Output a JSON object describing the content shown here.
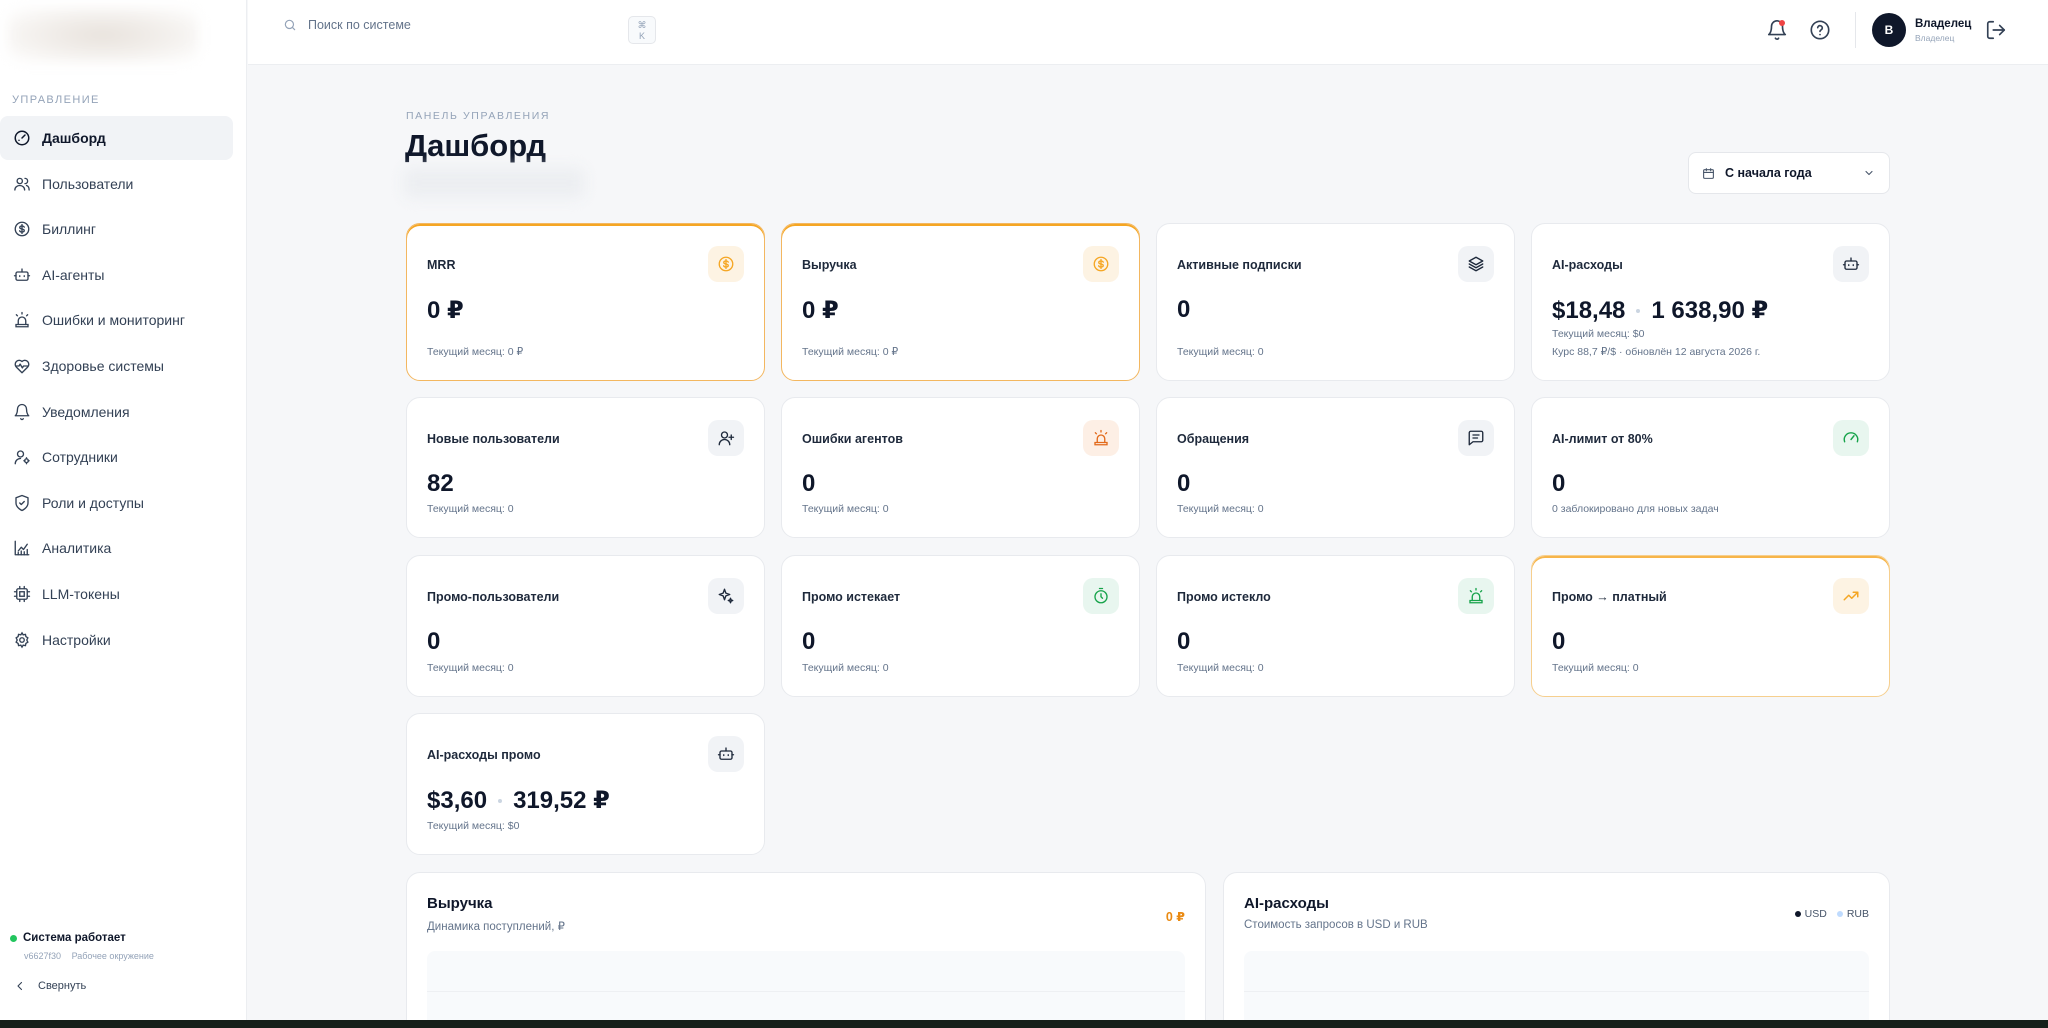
{
  "search": {
    "placeholder": "Поиск по системе",
    "shortcut_top": "⌘",
    "shortcut_bottom": "K"
  },
  "sidebar": {
    "section": "УПРАВЛЕНИЕ",
    "items": [
      {
        "label": "Дашборд",
        "icon": "gauge-icon",
        "active": true
      },
      {
        "label": "Пользователи",
        "icon": "users-icon"
      },
      {
        "label": "Биллинг",
        "icon": "dollar-circle-icon"
      },
      {
        "label": "AI-агенты",
        "icon": "bot-icon"
      },
      {
        "label": "Ошибки и мониторинг",
        "icon": "siren-icon"
      },
      {
        "label": "Здоровье системы",
        "icon": "heart-pulse-icon"
      },
      {
        "label": "Уведомления",
        "icon": "bell-icon"
      },
      {
        "label": "Сотрудники",
        "icon": "user-cog-icon"
      },
      {
        "label": "Роли и доступы",
        "icon": "shield-check-icon"
      },
      {
        "label": "Аналитика",
        "icon": "chart-line-icon"
      },
      {
        "label": "LLM-токены",
        "icon": "chip-icon"
      },
      {
        "label": "Настройки",
        "icon": "gear-icon"
      }
    ],
    "status": {
      "label": "Система работает",
      "version": "v6627f30",
      "environment": "Рабочее окружение"
    },
    "collapse_label": "Свернуть"
  },
  "user": {
    "initial": "В",
    "name": "Владелец",
    "role": "Владелец"
  },
  "header": {
    "eyebrow": "ПАНЕЛЬ УПРАВЛЕНИЯ",
    "title": "Дашборд",
    "period": "С начала года"
  },
  "colors": {
    "accent": "#f5a623",
    "success": "#22c55e",
    "danger": "#ef4444",
    "text": "#0f172a",
    "usd": "#0f172a",
    "rub": "#bfdbfe"
  },
  "cards": {
    "mrr": {
      "label": "MRR",
      "value": "0 ₽",
      "sub": "Текущий месяц: 0 ₽"
    },
    "revenue": {
      "label": "Выручка",
      "value": "0 ₽",
      "sub": "Текущий месяц: 0 ₽"
    },
    "subscriptions": {
      "label": "Активные подписки",
      "value": "0",
      "sub": "Текущий месяц: 0"
    },
    "ai_costs": {
      "label": "AI-расходы",
      "value_usd": "$18,48",
      "value_rub": "1 638,90 ₽",
      "sub": "Текущий месяц: $0",
      "sub2": "Курс 88,7 ₽/$ · обновлён 12 августа 2026 г."
    },
    "new_users": {
      "label": "Новые пользователи",
      "value": "82",
      "sub": "Текущий месяц: 0"
    },
    "agent_errors": {
      "label": "Ошибки агентов",
      "value": "0",
      "sub": "Текущий месяц: 0"
    },
    "tickets": {
      "label": "Обращения",
      "value": "0",
      "sub": "Текущий месяц: 0"
    },
    "ai_limit": {
      "label": "AI-лимит от 80%",
      "value": "0",
      "sub": "0 заблокировано для новых задач"
    },
    "promo_users": {
      "label": "Промо-пользователи",
      "value": "0",
      "sub": "Текущий месяц: 0"
    },
    "promo_expiring": {
      "label": "Промо истекает",
      "value": "0",
      "sub": "Текущий месяц: 0"
    },
    "promo_expired": {
      "label": "Промо истекло",
      "value": "0",
      "sub": "Текущий месяц: 0"
    },
    "promo_paid": {
      "label": "Промо → платный",
      "value": "0",
      "sub": "Текущий месяц: 0"
    },
    "ai_promo": {
      "label": "AI-расходы промо",
      "value_usd": "$3,60",
      "value_rub": "319,52 ₽",
      "sub": "Текущий месяц: $0"
    }
  },
  "charts": {
    "revenue": {
      "title": "Выручка",
      "subtitle": "Динамика поступлений, ₽",
      "total": "0 ₽"
    },
    "ai": {
      "title": "AI-расходы",
      "subtitle": "Стоимость запросов в USD и RUB",
      "legend": [
        "USD",
        "RUB"
      ]
    }
  }
}
